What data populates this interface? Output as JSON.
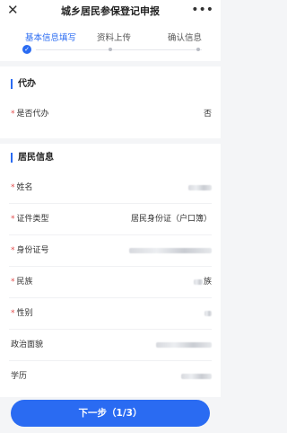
{
  "header": {
    "title": "城乡居民参保登记申报",
    "close_icon": "close-icon",
    "more_icon": "more-icon",
    "close_glyph": "✕",
    "more_glyph": "•••"
  },
  "steps": {
    "items": [
      {
        "label": "基本信息填写",
        "active": true
      },
      {
        "label": "资料上传",
        "active": false
      },
      {
        "label": "确认信息",
        "active": false
      }
    ],
    "check_glyph": "✓"
  },
  "proxy_section": {
    "title": "代办",
    "fields": [
      {
        "label": "是否代办",
        "required": true,
        "value": "否"
      }
    ]
  },
  "resident_section": {
    "title": "居民信息",
    "fields": [
      {
        "label": "姓名",
        "required": true,
        "value": ""
      },
      {
        "label": "证件类型",
        "required": true,
        "value": "居民身份证（户口簿）"
      },
      {
        "label": "身份证号",
        "required": true,
        "value": ""
      },
      {
        "label": "民族",
        "required": true,
        "value": "族"
      },
      {
        "label": "性别",
        "required": true,
        "value": ""
      },
      {
        "label": "政治面貌",
        "required": false,
        "value": ""
      },
      {
        "label": "学历",
        "required": false,
        "value": ""
      }
    ],
    "required_mark": "*"
  },
  "footer": {
    "next_label": "下一步（1/3）"
  },
  "colors": {
    "accent": "#2a6bf2",
    "required": "#e34d4d"
  }
}
